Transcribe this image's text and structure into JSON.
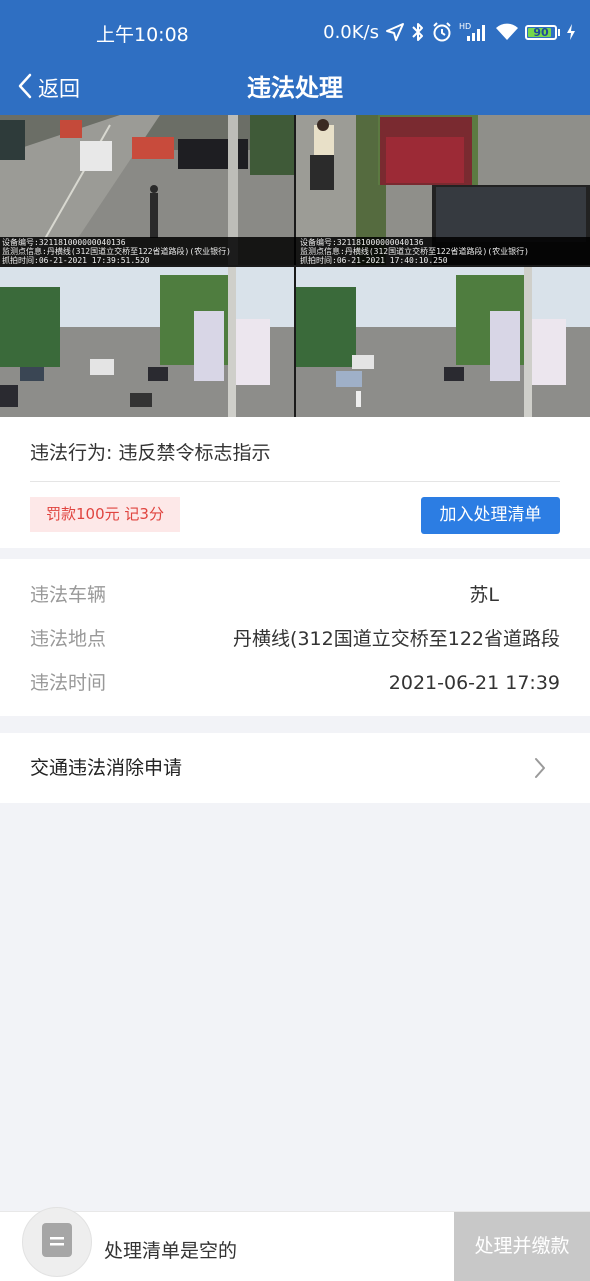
{
  "status_bar": {
    "time": "上午10:08",
    "network_speed": "0.0K/s",
    "battery_level": "90",
    "battery_percent": 90,
    "icons": [
      "location-arrow-icon",
      "bluetooth-icon",
      "alarm-icon",
      "hd-signal-icon",
      "wifi-icon",
      "battery-icon",
      "charging-icon"
    ]
  },
  "nav": {
    "back_label": "返回",
    "title": "违法处理"
  },
  "photos": {
    "top_info": {
      "device_line": "设备编号:321181000000040136",
      "location_line": "监测点信息:丹横线(312国道立交桥至122省道路段)(农业银行)",
      "time_line_1": "抓拍时间:06-21-2021 17:39:51.520",
      "time_line_2": "抓拍时间:06-21-2021 17:40:10.250"
    }
  },
  "violation": {
    "behavior_label": "违法行为:",
    "behavior_value": "违反禁令标志指示",
    "penalty": "罚款100元 记3分",
    "add_button": "加入处理清单"
  },
  "details": [
    {
      "label": "违法车辆",
      "value": "苏L"
    },
    {
      "label": "违法地点",
      "value": "丹横线(312国道立交桥至122省道路段"
    },
    {
      "label": "违法时间",
      "value": "2021-06-21 17:39"
    }
  ],
  "eliminate": {
    "label": "交通违法消除申请"
  },
  "bottom": {
    "cart_text": "处理清单是空的",
    "checkout_button": "处理并缴款"
  },
  "colors": {
    "header_blue": "#2f6fc2",
    "button_blue": "#2c7de3",
    "penalty_red": "#e0443f",
    "penalty_bg": "#fde8e8",
    "disabled_gray": "#c8c8c8",
    "battery_green": "#76d84a"
  }
}
